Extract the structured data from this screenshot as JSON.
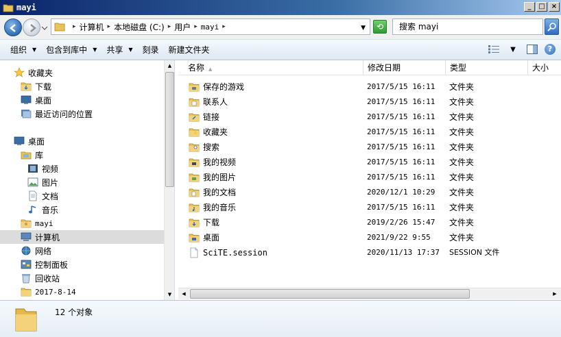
{
  "window": {
    "title": "mayi",
    "controls": {
      "minimize": "_",
      "maximize": "□",
      "close": "×"
    }
  },
  "address": {
    "breadcrumbs": [
      "计算机",
      "本地磁盘 (C:)",
      "用户",
      "mayi"
    ],
    "search_placeholder": "搜索 mayi"
  },
  "toolbar": {
    "organize": "组织",
    "include_library": "包含到库中",
    "share": "共享",
    "burn": "刻录",
    "new_folder": "新建文件夹",
    "help": "?"
  },
  "sidebar": {
    "items": [
      {
        "label": "收藏夹",
        "icon": "star-icon",
        "indent": 0
      },
      {
        "label": "下载",
        "icon": "download-folder-icon",
        "indent": 1
      },
      {
        "label": "桌面",
        "icon": "desktop-icon",
        "indent": 1
      },
      {
        "label": "最近访问的位置",
        "icon": "recent-places-icon",
        "indent": 1
      },
      {
        "label": "桌面",
        "icon": "desktop-icon",
        "indent": 0
      },
      {
        "label": "库",
        "icon": "library-icon",
        "indent": 1
      },
      {
        "label": "视频",
        "icon": "video-icon",
        "indent": 2
      },
      {
        "label": "图片",
        "icon": "picture-icon",
        "indent": 2
      },
      {
        "label": "文档",
        "icon": "document-icon",
        "indent": 2
      },
      {
        "label": "音乐",
        "icon": "music-icon",
        "indent": 2
      },
      {
        "label": "mayi",
        "icon": "user-folder-icon",
        "indent": 1
      },
      {
        "label": "计算机",
        "icon": "computer-icon",
        "indent": 1,
        "selected": true
      },
      {
        "label": "网络",
        "icon": "network-icon",
        "indent": 1
      },
      {
        "label": "控制面板",
        "icon": "control-panel-icon",
        "indent": 1
      },
      {
        "label": "回收站",
        "icon": "recycle-bin-icon",
        "indent": 1
      },
      {
        "label": "2017-8-14",
        "icon": "folder-icon",
        "indent": 1
      }
    ]
  },
  "filelist": {
    "columns": [
      "名称",
      "修改日期",
      "类型",
      "大小"
    ],
    "rows": [
      {
        "name": "保存的游戏",
        "date": "2017/5/15 16:11",
        "type": "文件夹",
        "icon": "saved-games-folder-icon"
      },
      {
        "name": "联系人",
        "date": "2017/5/15 16:11",
        "type": "文件夹",
        "icon": "contacts-folder-icon"
      },
      {
        "name": "链接",
        "date": "2017/5/15 16:11",
        "type": "文件夹",
        "icon": "links-folder-icon"
      },
      {
        "name": "收藏夹",
        "date": "2017/5/15 16:11",
        "type": "文件夹",
        "icon": "favorites-folder-icon"
      },
      {
        "name": "搜索",
        "date": "2017/5/15 16:11",
        "type": "文件夹",
        "icon": "searches-folder-icon"
      },
      {
        "name": "我的视频",
        "date": "2017/5/15 16:11",
        "type": "文件夹",
        "icon": "videos-folder-icon"
      },
      {
        "name": "我的图片",
        "date": "2017/5/15 16:11",
        "type": "文件夹",
        "icon": "pictures-folder-icon"
      },
      {
        "name": "我的文档",
        "date": "2020/12/1 10:29",
        "type": "文件夹",
        "icon": "documents-folder-icon"
      },
      {
        "name": "我的音乐",
        "date": "2017/5/15 16:11",
        "type": "文件夹",
        "icon": "music-folder-icon"
      },
      {
        "name": "下载",
        "date": "2019/2/26 15:47",
        "type": "文件夹",
        "icon": "downloads-folder-icon"
      },
      {
        "name": "桌面",
        "date": "2021/9/22 9:55",
        "type": "文件夹",
        "icon": "desktop-folder-icon"
      },
      {
        "name": "SciTE.session",
        "date": "2020/11/13 17:37",
        "type": "SESSION 文件",
        "icon": "file-icon"
      }
    ]
  },
  "details": {
    "count_text": "12 个对象"
  }
}
